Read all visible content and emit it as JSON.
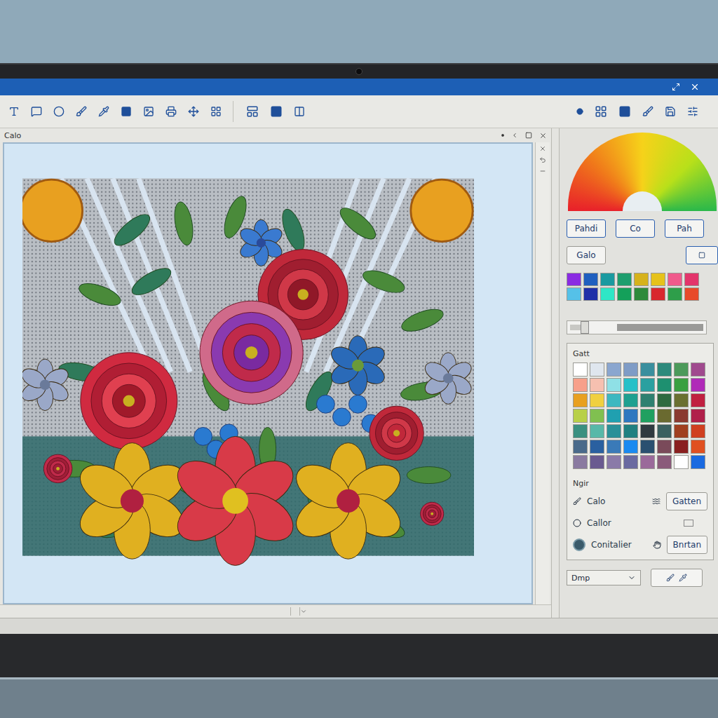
{
  "canvas": {
    "title": "Calo"
  },
  "tool_buttons": [
    {
      "label": "Pahdi"
    },
    {
      "label": "Co"
    },
    {
      "label": "Pah"
    }
  ],
  "name_button": {
    "label": "Galo"
  },
  "top_swatches": [
    "#8a2be2",
    "#1f5fbf",
    "#1a9aa0",
    "#1e9e6e",
    "#d6b21c",
    "#e6c21a",
    "#f05a8c",
    "#e3356b",
    "#55c1e8",
    "#1f2fa8",
    "#2ee6c6",
    "#14a05a",
    "#2e8a3a",
    "#d8282e",
    "#2e9e4a",
    "#e84a2a"
  ],
  "slider": {
    "level": 0.08
  },
  "palette": {
    "title": "Gatt",
    "colors": [
      "#ffffff",
      "#dfe6ee",
      "#8aa6cf",
      "#7f9cc6",
      "#3a8f9e",
      "#2d8a7c",
      "#4c9a5a",
      "#a04a8e",
      "#f7a08a",
      "#f6c0b0",
      "#8fe0e6",
      "#27c0c8",
      "#2aa0a0",
      "#1e9070",
      "#3aa040",
      "#b02ab8",
      "#e8a020",
      "#f0d040",
      "#3cb8c0",
      "#1ea090",
      "#2e8070",
      "#2e6a40",
      "#6a7030",
      "#c02040",
      "#b8d048",
      "#80c050",
      "#20a0b0",
      "#2e78c0",
      "#20a060",
      "#6a6a30",
      "#8a3a30",
      "#b0204a",
      "#3a9080",
      "#58b8a8",
      "#2a9098",
      "#208080",
      "#303a40",
      "#3a6060",
      "#a04020",
      "#d04020",
      "#4a6a8a",
      "#2a60a0",
      "#3a7ab8",
      "#1a8af0",
      "#2a5070",
      "#7a4a5a",
      "#8a2020",
      "#e05020",
      "#8a7aa0",
      "#6a5a90",
      "#8a7aa8",
      "#6a6aa0",
      "#9a6a9a",
      "#8a5a7a",
      "#ffffff",
      "#1a6ae0"
    ]
  },
  "options": {
    "title": "Ngir",
    "rows": [
      {
        "label": "Calo",
        "kind": "button",
        "button": "Gatten"
      },
      {
        "label": "Callor",
        "kind": "box"
      },
      {
        "label": "Conitalier",
        "kind": "radio",
        "button": "Bnrtan"
      }
    ]
  },
  "dropdown": {
    "value": "Dmp"
  }
}
